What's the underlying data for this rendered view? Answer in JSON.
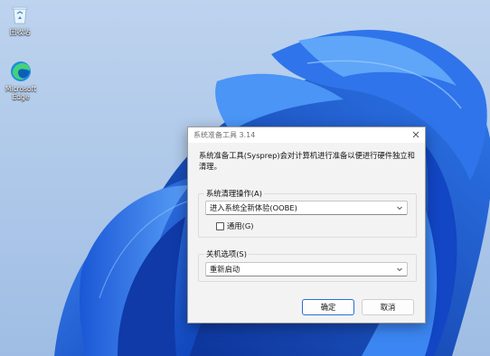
{
  "desktop": {
    "icons": [
      {
        "label": "回收站"
      },
      {
        "label": "Microsoft Edge"
      }
    ]
  },
  "dialog": {
    "title": "系统准备工具 3.14",
    "description": "系统准备工具(Sysprep)会对计算机进行准备以便进行硬件独立和清理。",
    "cleanup_group": {
      "label": "系统清理操作(A)",
      "selected": "进入系统全新体验(OOBE)",
      "generalize_label": "通用(G)",
      "generalize_checked": false
    },
    "shutdown_group": {
      "label": "关机选项(S)",
      "selected": "重新启动"
    },
    "ok_label": "确定",
    "cancel_label": "取消"
  },
  "colors": {
    "accent": "#2a6fd1",
    "dialog_bg": "#f3f3f3",
    "wallpaper_bloom": "#1d5fe0"
  }
}
